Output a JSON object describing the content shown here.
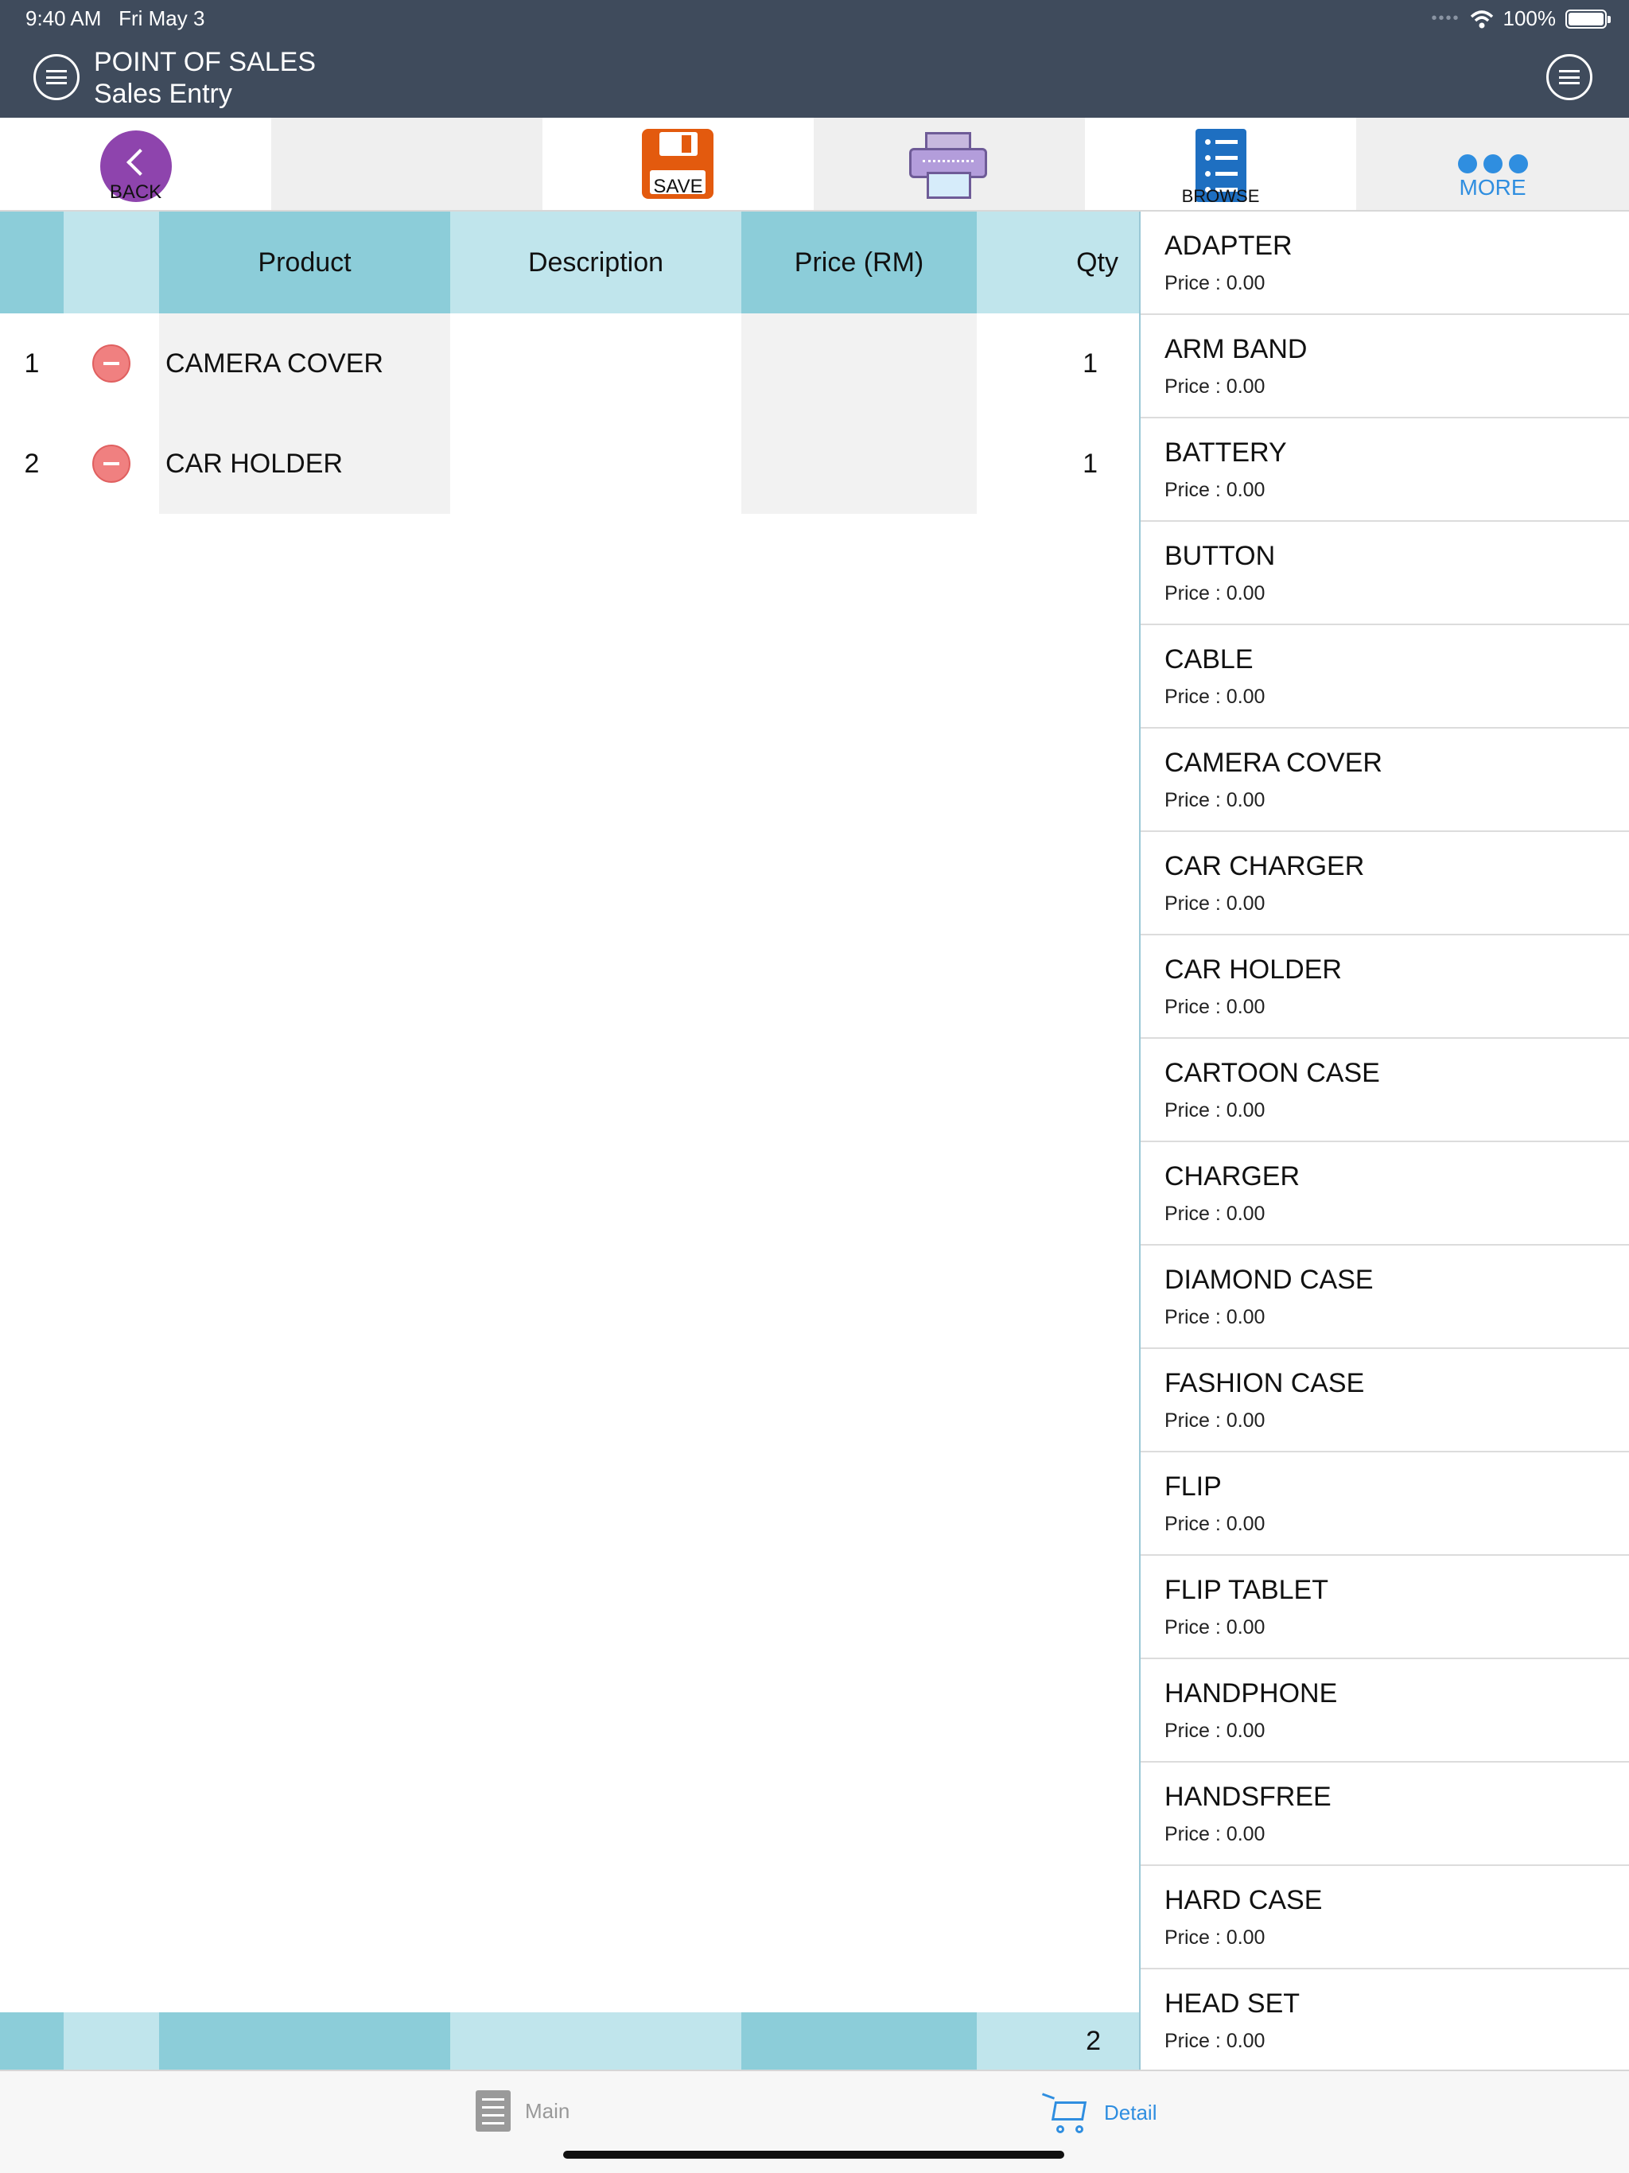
{
  "status_bar": {
    "time": "9:40 AM",
    "date": "Fri May 3",
    "battery": "100%",
    "battery_level": 1.0
  },
  "header": {
    "title": "POINT OF SALES",
    "subtitle": "Sales Entry"
  },
  "toolbar": {
    "back_label": "BACK",
    "save_label": "SAVE",
    "browse_label": "BROWSE",
    "more_label": "MORE"
  },
  "grid": {
    "columns": [
      "Product",
      "Description",
      "Price (RM)",
      "Qty"
    ],
    "rows": [
      {
        "no": "1",
        "product": "CAMERA COVER",
        "description": "",
        "price": "",
        "qty": "1"
      },
      {
        "no": "2",
        "product": "CAR HOLDER",
        "description": "",
        "price": "",
        "qty": "1"
      }
    ],
    "total_qty": "2"
  },
  "products": [
    {
      "name": "ADAPTER",
      "price": "Price : 0.00"
    },
    {
      "name": "ARM BAND",
      "price": "Price : 0.00"
    },
    {
      "name": "BATTERY",
      "price": "Price : 0.00"
    },
    {
      "name": "BUTTON",
      "price": "Price : 0.00"
    },
    {
      "name": "CABLE",
      "price": "Price : 0.00"
    },
    {
      "name": "CAMERA COVER",
      "price": "Price : 0.00"
    },
    {
      "name": "CAR CHARGER",
      "price": "Price : 0.00"
    },
    {
      "name": "CAR HOLDER",
      "price": "Price : 0.00"
    },
    {
      "name": "CARTOON CASE",
      "price": "Price : 0.00"
    },
    {
      "name": "CHARGER",
      "price": "Price : 0.00"
    },
    {
      "name": "DIAMOND CASE",
      "price": "Price : 0.00"
    },
    {
      "name": "FASHION CASE",
      "price": "Price : 0.00"
    },
    {
      "name": "FLIP",
      "price": "Price : 0.00"
    },
    {
      "name": "FLIP TABLET",
      "price": "Price : 0.00"
    },
    {
      "name": "HANDPHONE",
      "price": "Price : 0.00"
    },
    {
      "name": "HANDSFREE",
      "price": "Price : 0.00"
    },
    {
      "name": "HARD CASE",
      "price": "Price : 0.00"
    },
    {
      "name": "HEAD SET",
      "price": "Price : 0.00"
    }
  ],
  "tabbar": {
    "main_label": "Main",
    "detail_label": "Detail",
    "active": "Detail"
  },
  "colors": {
    "header_bg": "#3f4b5c",
    "col_dark": "#8ccdd9",
    "col_light": "#c0e5ec",
    "back_purple": "#8e44ad",
    "save_orange": "#e35a0e",
    "browse_blue": "#1e6fc1",
    "accent_blue": "#2f8ee0",
    "remove_red": "#f08080"
  },
  "icons": {
    "menu": "hamburger-circle-icon",
    "back": "chevron-left-circle-icon",
    "save": "floppy-disk-icon",
    "print": "printer-icon",
    "browse": "list-icon",
    "more": "three-dots-icon",
    "remove": "minus-circle-icon",
    "main_tab": "list-icon",
    "detail_tab": "cart-icon"
  }
}
